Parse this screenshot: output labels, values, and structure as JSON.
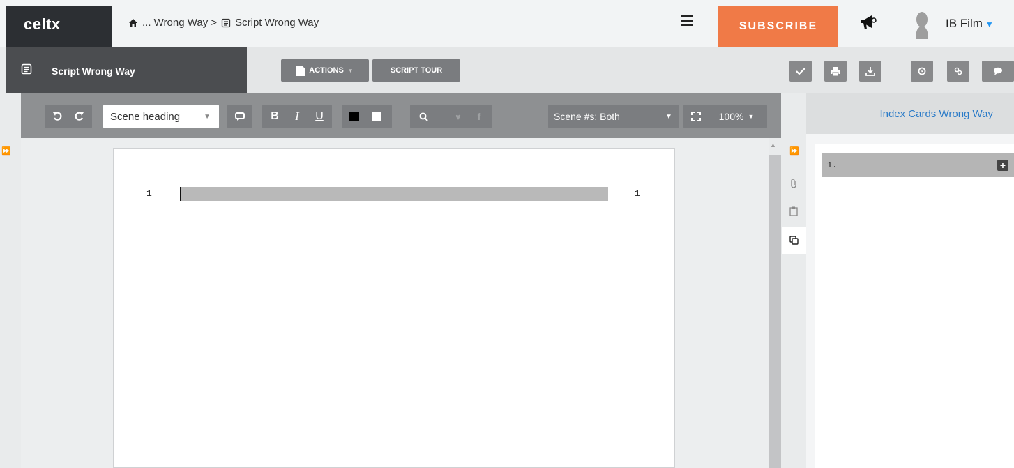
{
  "brand": {
    "logo": "celtx"
  },
  "breadcrumb": {
    "path": "... Wrong Way >",
    "current": "Script Wrong Way"
  },
  "header": {
    "subscribe_label": "SUBSCRIBE",
    "user_name": "IB Film"
  },
  "doc_tab": {
    "title": "Script Wrong Way"
  },
  "actions": {
    "actions_label": "ACTIONS",
    "script_tour_label": "SCRIPT TOUR"
  },
  "editor_toolbar": {
    "element_type": "Scene heading",
    "bold": "B",
    "italic": "I",
    "underline": "U",
    "scene_numbers": "Scene #s: Both",
    "zoom": "100%"
  },
  "script": {
    "scene_number_left": "1",
    "scene_number_right": "1"
  },
  "index_cards": {
    "title": "Index Cards Wrong Way",
    "cards": [
      {
        "label": "1."
      }
    ]
  },
  "colors": {
    "accent": "#f07a47",
    "link": "#2b7bc8",
    "dark": "#2c2f33"
  }
}
